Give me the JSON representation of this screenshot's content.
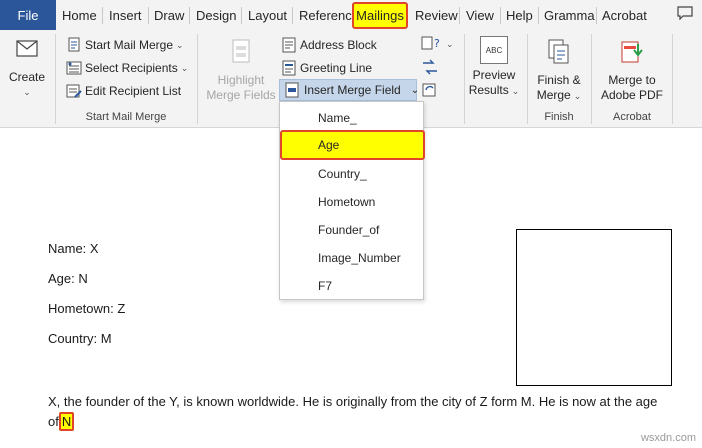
{
  "tabs": {
    "file": "File",
    "home": "Home",
    "insert": "Insert",
    "draw": "Draw",
    "design": "Design",
    "layout": "Layout",
    "references": "Referenc",
    "mailings": "Mailings",
    "review": "Review",
    "view": "View",
    "help": "Help",
    "grammarly": "Gramma",
    "acrobat": "Acrobat"
  },
  "ribbon": {
    "create_label": "Create",
    "start_mail_merge": "Start Mail Merge",
    "select_recipients": "Select Recipients",
    "edit_recipient_list": "Edit Recipient List",
    "group_start_mail_merge": "Start Mail Merge",
    "highlight_merge_fields_1": "Highlight",
    "highlight_merge_fields_2": "Merge Fields",
    "address_block": "Address Block",
    "greeting_line": "Greeting Line",
    "insert_merge_field": "Insert Merge Field",
    "preview_results_1": "Preview",
    "preview_results_2": "Results",
    "preview_abc": "ABC",
    "finish_merge_1": "Finish &",
    "finish_merge_2": "Merge",
    "group_finish": "Finish",
    "merge_adobe_1": "Merge to",
    "merge_adobe_2": "Adobe PDF",
    "group_acrobat": "Acrobat"
  },
  "dropdown": {
    "items": [
      "Name_",
      "Age",
      "Country_",
      "Hometown",
      "Founder_of",
      "Image_Number",
      "F7"
    ],
    "selected": "Age"
  },
  "document": {
    "line_name": "Name: X",
    "line_age": "Age: N",
    "line_hometown": "Hometown: Z",
    "line_country": "Country: M",
    "paragraph": "X, the founder of the Y, is known worldwide. He is originally from the city of Z form M. He is now at the age of",
    "field_value": "N"
  },
  "watermark": "wsxdn.com",
  "colors": {
    "file_tab": "#2b579a",
    "highlight": "#ffff00",
    "highlight_border": "#e0452a",
    "ribbon_bg": "#f3f3f3"
  }
}
